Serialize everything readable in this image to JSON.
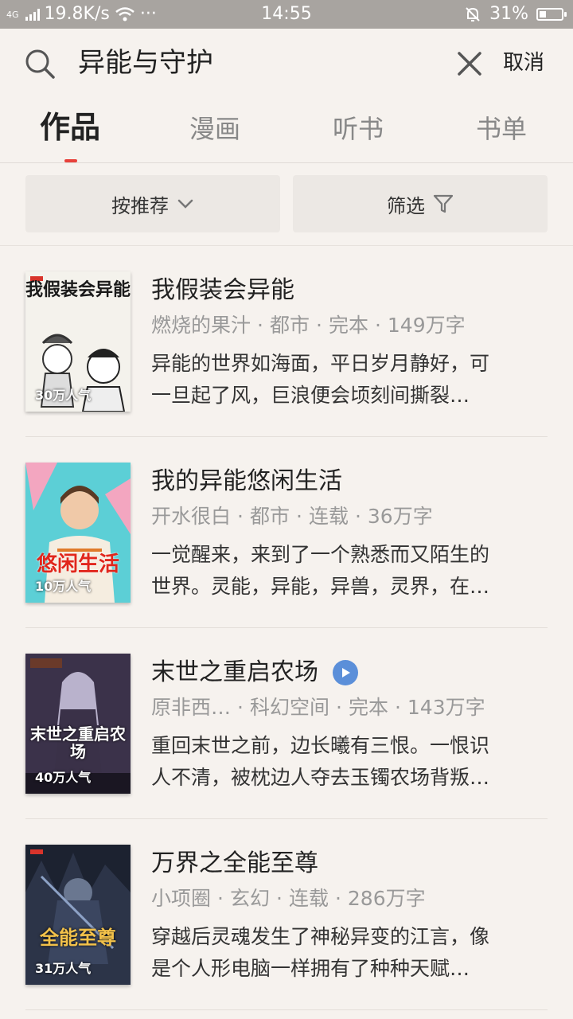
{
  "status_bar": {
    "network": "4G",
    "speed": "19.8K/s",
    "time": "14:55",
    "battery": "31%",
    "battery_level": 0.31
  },
  "search": {
    "query": "异能与守护",
    "cancel_label": "取消"
  },
  "tabs": [
    {
      "label": "作品",
      "active": true
    },
    {
      "label": "漫画",
      "active": false
    },
    {
      "label": "听书",
      "active": false
    },
    {
      "label": "书单",
      "active": false
    }
  ],
  "filters": {
    "sort_label": "按推荐",
    "filter_label": "筛选"
  },
  "books": [
    {
      "title": "我假装会异能",
      "author": "燃烧的果汁",
      "category": "都市",
      "status": "完本",
      "words": "149万字",
      "desc_line1": "异能的世界如海面，平日岁月静好，可",
      "desc_line2": "一旦起了风，巨浪便会顷刻间撕裂…",
      "popularity": "30万人气",
      "cover_title": "我假装会异能",
      "has_audio": false
    },
    {
      "title": "我的异能悠闲生活",
      "author": "开水很白",
      "category": "都市",
      "status": "连载",
      "words": "36万字",
      "desc_line1": "一觉醒来，来到了一个熟悉而又陌生的",
      "desc_line2": "世界。灵能，异能，异兽，灵界，在…",
      "popularity": "10万人气",
      "cover_title": "悠闲生活",
      "has_audio": false
    },
    {
      "title": "末世之重启农场",
      "author": "原非西…",
      "category": "科幻空间",
      "status": "完本",
      "words": "143万字",
      "desc_line1": "重回末世之前，边长曦有三恨。一恨识",
      "desc_line2": "人不清，被枕边人夺去玉镯农场背叛…",
      "popularity": "40万人气",
      "cover_title": "末世之重启农场",
      "has_audio": true
    },
    {
      "title": "万界之全能至尊",
      "author": "小项圈",
      "category": "玄幻",
      "status": "连载",
      "words": "286万字",
      "desc_line1": "穿越后灵魂发生了神秘异变的江言，像",
      "desc_line2": "是个人形电脑一样拥有了种种天赋…",
      "popularity": "31万人气",
      "cover_title": "全能至尊",
      "has_audio": false
    }
  ],
  "colors": {
    "background": "#f6f2ee",
    "accent": "#e8413b",
    "audio_badge": "#5b8fd9"
  }
}
